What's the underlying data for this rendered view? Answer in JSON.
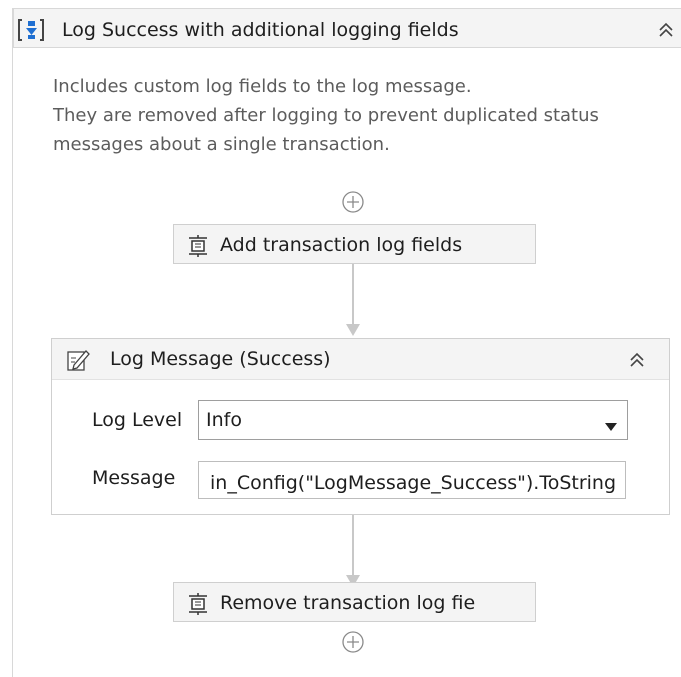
{
  "sequence": {
    "title": "Log Success with additional logging fields",
    "icon": "sequence-icon",
    "collapse_icon": "double-chevron-up-icon"
  },
  "annotation": {
    "lines": [
      "Includes custom log fields to the log message.",
      "They are removed after logging to prevent duplicated status",
      "messages about a single transaction."
    ]
  },
  "activities": {
    "add_fields": {
      "label": "Add transaction log fields",
      "icon": "invoke-workflow-icon"
    },
    "remove_fields": {
      "label": "Remove transaction log fie",
      "icon": "invoke-workflow-icon"
    }
  },
  "log_message": {
    "title": "Log Message (Success)",
    "icon": "log-message-icon",
    "log_level_label": "Log Level",
    "log_level_value": "Info",
    "message_label": "Message",
    "message_value": "in_Config(\"LogMessage_Success\").ToString"
  },
  "colors": {
    "header_bg": "#f4f4f4",
    "border": "#cfcfcf",
    "icon_blue": "#1f6fd1",
    "connector": "#c8c8c8"
  }
}
